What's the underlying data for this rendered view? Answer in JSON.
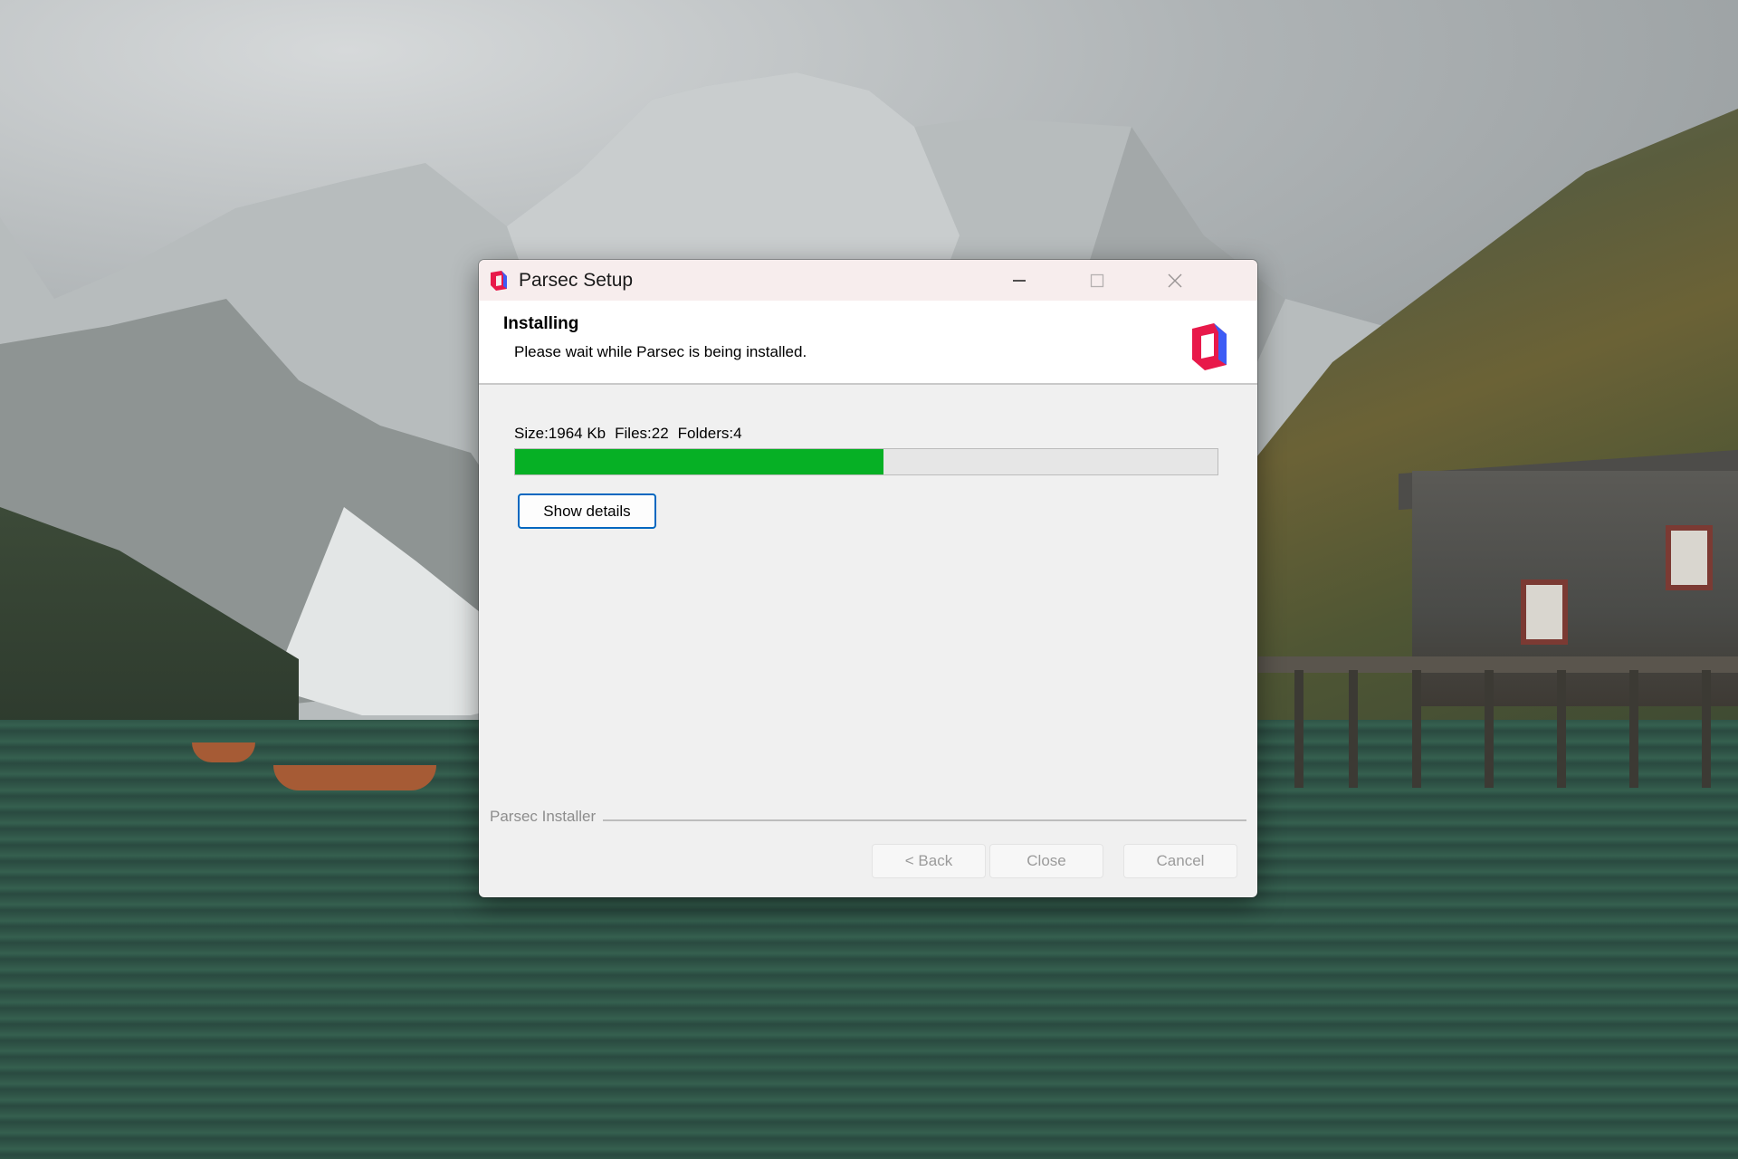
{
  "window": {
    "title": "Parsec Setup",
    "icon": "parsec-logo-icon",
    "controls": [
      "minimize-icon",
      "maximize-icon",
      "close-icon"
    ]
  },
  "header": {
    "title": "Installing",
    "subtitle": "Please wait while Parsec is being installed.",
    "logo": "parsec-logo-icon"
  },
  "install": {
    "size": "Size:1964 Kb",
    "files": "Files:22",
    "folders": "Folders:4",
    "progress_fraction": 0.525,
    "show_details_label": "Show details"
  },
  "footer": {
    "group_label": "Parsec Installer",
    "back_label": "< Back",
    "close_label": "Close",
    "cancel_label": "Cancel"
  },
  "colors": {
    "progress_fill": "#06b025",
    "accent": "#0067c0",
    "logo_red": "#e8194a",
    "logo_blue": "#3d5cf5"
  }
}
